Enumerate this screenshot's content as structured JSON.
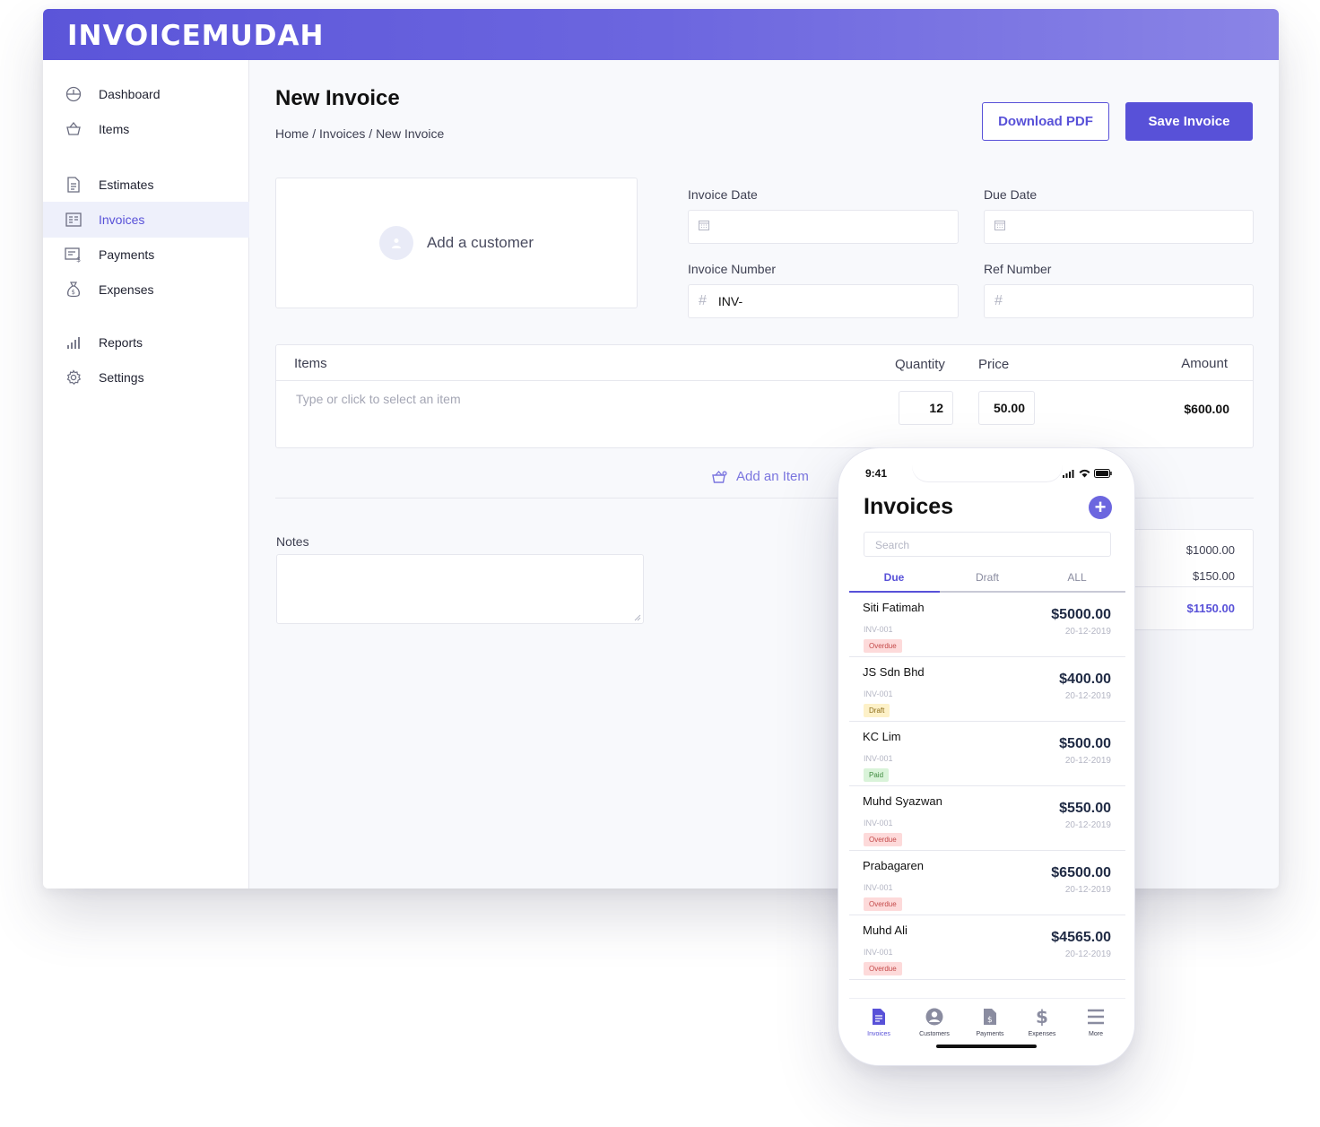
{
  "app": {
    "logo": "INVOICEMUDAH"
  },
  "sidebar": {
    "items": [
      {
        "label": "Dashboard",
        "icon": "dashboard-icon"
      },
      {
        "label": "Items",
        "icon": "basket-icon"
      },
      {
        "label": "Estimates",
        "icon": "document-icon"
      },
      {
        "label": "Invoices",
        "icon": "invoice-icon",
        "active": true
      },
      {
        "label": "Payments",
        "icon": "payment-icon"
      },
      {
        "label": "Expenses",
        "icon": "moneybag-icon"
      },
      {
        "label": "Reports",
        "icon": "bar-chart-icon"
      },
      {
        "label": "Settings",
        "icon": "gear-icon"
      }
    ]
  },
  "header": {
    "title": "New Invoice",
    "breadcrumb": [
      "Home",
      "Invoices",
      "New Invoice"
    ],
    "breadcrumb_sep": " / ",
    "download_label": "Download PDF",
    "save_label": "Save Invoice"
  },
  "customer": {
    "label": "Add a customer"
  },
  "form": {
    "invoice_date_label": "Invoice Date",
    "invoice_date_value": "",
    "due_date_label": "Due Date",
    "due_date_value": "",
    "invoice_number_label": "Invoice Number",
    "invoice_number_value": "INV-",
    "ref_number_label": "Ref Number",
    "ref_number_value": ""
  },
  "items_table": {
    "headers": {
      "items": "Items",
      "quantity": "Quantity",
      "price": "Price",
      "amount": "Amount"
    },
    "placeholder": "Type  or click to select an item",
    "row": {
      "quantity": "12",
      "price": "50.00",
      "amount": "$600.00"
    },
    "add_item_label": "Add an Item"
  },
  "notes": {
    "label": "Notes",
    "value": ""
  },
  "totals": {
    "subtotal": "$1000.00",
    "tax": "$150.00",
    "total": "$1150.00"
  },
  "mobile": {
    "time": "9:41",
    "title": "Invoices",
    "search_placeholder": "Search",
    "tabs": [
      "Due",
      "Draft",
      "ALL"
    ],
    "invoices": [
      {
        "name": "Siti Fatimah",
        "number": "INV-001",
        "status": "Overdue",
        "amount": "$5000.00",
        "date": "20-12-2019"
      },
      {
        "name": "JS Sdn Bhd",
        "number": "INV-001",
        "status": "Draft",
        "amount": "$400.00",
        "date": "20-12-2019"
      },
      {
        "name": "KC Lim",
        "number": "INV-001",
        "status": "Paid",
        "amount": "$500.00",
        "date": "20-12-2019"
      },
      {
        "name": "Muhd Syazwan",
        "number": "INV-001",
        "status": "Overdue",
        "amount": "$550.00",
        "date": "20-12-2019"
      },
      {
        "name": "Prabagaren",
        "number": "INV-001",
        "status": "Overdue",
        "amount": "$6500.00",
        "date": "20-12-2019"
      },
      {
        "name": "Muhd Ali",
        "number": "INV-001",
        "status": "Overdue",
        "amount": "$4565.00",
        "date": "20-12-2019"
      }
    ],
    "bottom_nav": [
      {
        "label": "Invoices",
        "icon": "invoice-icon",
        "active": true
      },
      {
        "label": "Customers",
        "icon": "user-icon"
      },
      {
        "label": "Payments",
        "icon": "payment-icon"
      },
      {
        "label": "Expenses",
        "icon": "dollar-icon"
      },
      {
        "label": "More",
        "icon": "menu-icon"
      }
    ]
  },
  "colors": {
    "brand": "#5851d8",
    "brand_light": "#8a84e6",
    "overdue": "#fddada",
    "draft": "#fdf1c8",
    "paid": "#d9f3d9"
  }
}
